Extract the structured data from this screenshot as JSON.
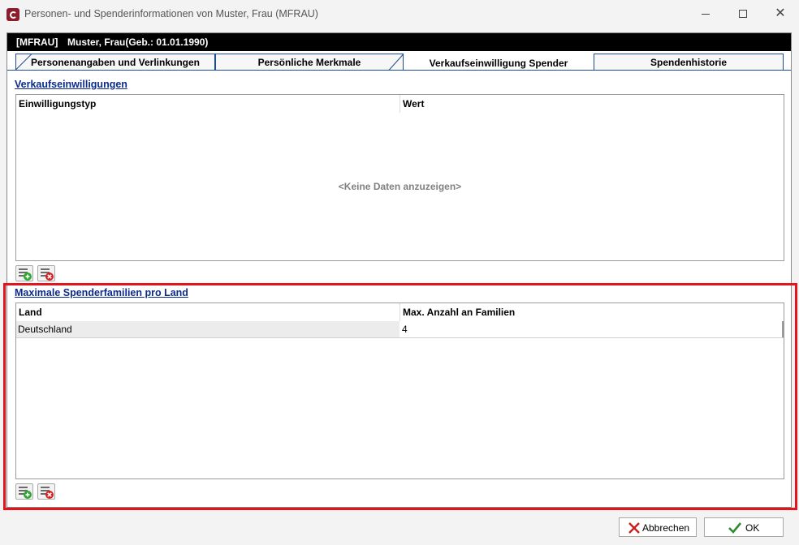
{
  "window": {
    "title": "Personen- und Spenderinformationen  von Muster, Frau (MFRAU)",
    "icons": [
      "app-logo-icon",
      "minimize-icon",
      "maximize-icon",
      "close-icon"
    ]
  },
  "header": {
    "code": "[MFRAU]",
    "name": "Muster, Frau(Geb.: 01.01.1990)"
  },
  "tabs": [
    {
      "label": "Personenangaben und Verlinkungen",
      "active": false
    },
    {
      "label": "Persönliche Merkmale",
      "active": false
    },
    {
      "label": "Verkaufseinwilligung Spender",
      "active": true
    },
    {
      "label": "Spendenhistorie",
      "active": false
    }
  ],
  "consents": {
    "title": "Verkaufseinwilligungen",
    "columns": [
      "Einwilligungstyp",
      "Wert"
    ],
    "empty_message": "<Keine Daten anzuzeigen>"
  },
  "families": {
    "title": "Maximale Spenderfamilien pro Land",
    "columns": [
      "Land",
      "Max. Anzahl an Familien"
    ],
    "rows": [
      {
        "land": "Deutschland",
        "max": "4"
      }
    ]
  },
  "buttons": {
    "cancel": "Abbrechen",
    "ok": "OK"
  },
  "colors": {
    "header_bg": "#000000",
    "tab_border": "#1d4b8f",
    "section_title": "#0b2b8c",
    "highlight": "#e3141b"
  }
}
